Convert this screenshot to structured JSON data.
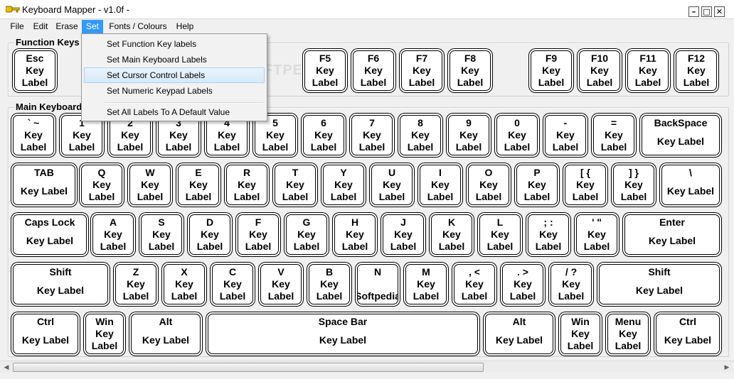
{
  "window": {
    "title": "Keyboard Mapper - v1.0f  -",
    "min": "–",
    "max": "□",
    "close": "✕"
  },
  "menu": {
    "items": [
      "File",
      "Edit",
      "Erase",
      "Set",
      "Fonts / Colours",
      "Help"
    ],
    "active": "Set"
  },
  "dropdown": {
    "items": [
      "Set Function Key labels",
      "Set Main Keyboard Labels",
      "Set Cursor Control Labels",
      "Set Numeric Keypad Labels",
      "Set All Labels To A Default Value"
    ],
    "hover_index": 2
  },
  "groups": {
    "function_keys": "Function Keys",
    "main_keyboard": "Main Keyboard"
  },
  "watermark": "SOFTPEDIA",
  "function_keys": [
    {
      "name": "Esc",
      "label": "Key Label"
    },
    {
      "name": "F5",
      "label": "Key Label"
    },
    {
      "name": "F6",
      "label": "Key Label"
    },
    {
      "name": "F7",
      "label": "Key Label"
    },
    {
      "name": "F8",
      "label": "Key Label"
    },
    {
      "name": "F9",
      "label": "Key Label"
    },
    {
      "name": "F10",
      "label": "Key Label"
    },
    {
      "name": "F11",
      "label": "Key Label"
    },
    {
      "name": "F12",
      "label": "Key Label"
    }
  ],
  "rows": [
    [
      {
        "name": "` ~",
        "label": "Key Label"
      },
      {
        "name": "1",
        "label": "Key Label"
      },
      {
        "name": "2",
        "label": "Key Label"
      },
      {
        "name": "3",
        "label": "Key Label"
      },
      {
        "name": "4",
        "label": "Key Label"
      },
      {
        "name": "5",
        "label": "Key Label"
      },
      {
        "name": "6",
        "label": "Key Label"
      },
      {
        "name": "7",
        "label": "Key Label"
      },
      {
        "name": "8",
        "label": "Key Label"
      },
      {
        "name": "9",
        "label": "Key Label"
      },
      {
        "name": "0",
        "label": "Key Label"
      },
      {
        "name": "-",
        "label": "Key Label"
      },
      {
        "name": "=",
        "label": "Key Label"
      },
      {
        "name": "BackSpace",
        "label": "Key Label"
      }
    ],
    [
      {
        "name": "TAB",
        "label": "Key Label"
      },
      {
        "name": "Q",
        "label": "Key Label"
      },
      {
        "name": "W",
        "label": "Key Label"
      },
      {
        "name": "E",
        "label": "Key Label"
      },
      {
        "name": "R",
        "label": "Key Label"
      },
      {
        "name": "T",
        "label": "Key Label"
      },
      {
        "name": "Y",
        "label": "Key Label"
      },
      {
        "name": "U",
        "label": "Key Label"
      },
      {
        "name": "I",
        "label": "Key Label"
      },
      {
        "name": "O",
        "label": "Key Label"
      },
      {
        "name": "P",
        "label": "Key Label"
      },
      {
        "name": "[ {",
        "label": "Key Label"
      },
      {
        "name": "] }",
        "label": "Key Label"
      },
      {
        "name": "\\",
        "label": "Key Label"
      }
    ],
    [
      {
        "name": "Caps Lock",
        "label": "Key Label"
      },
      {
        "name": "A",
        "label": "Key Label"
      },
      {
        "name": "S",
        "label": "Key Label"
      },
      {
        "name": "D",
        "label": "Key Label"
      },
      {
        "name": "F",
        "label": "Key Label"
      },
      {
        "name": "G",
        "label": "Key Label"
      },
      {
        "name": "H",
        "label": "Key Label"
      },
      {
        "name": "J",
        "label": "Key Label"
      },
      {
        "name": "K",
        "label": "Key Label"
      },
      {
        "name": "L",
        "label": "Key Label"
      },
      {
        "name": "; :",
        "label": "Key Label"
      },
      {
        "name": "' \"",
        "label": "Key Label"
      },
      {
        "name": "Enter",
        "label": "Key Label"
      }
    ],
    [
      {
        "name": "Shift",
        "label": "Key Label"
      },
      {
        "name": "Z",
        "label": "Key Label"
      },
      {
        "name": "X",
        "label": "Key Label"
      },
      {
        "name": "C",
        "label": "Key Label"
      },
      {
        "name": "V",
        "label": "Key Label"
      },
      {
        "name": "B",
        "label": "Key Label"
      },
      {
        "name": "N",
        "label": "Softpedia"
      },
      {
        "name": "M",
        "label": "Key Label"
      },
      {
        "name": ", <",
        "label": "Key Label"
      },
      {
        "name": ". >",
        "label": "Key Label"
      },
      {
        "name": "/ ?",
        "label": "Key Label"
      },
      {
        "name": "Shift",
        "label": "Key Label"
      }
    ],
    [
      {
        "name": "Ctrl",
        "label": "Key Label"
      },
      {
        "name": "Win",
        "label": "Key Label"
      },
      {
        "name": "Alt",
        "label": "Key Label"
      },
      {
        "name": "Space Bar",
        "label": "Key Label"
      },
      {
        "name": "Alt",
        "label": "Key Label"
      },
      {
        "name": "Win",
        "label": "Key Label"
      },
      {
        "name": "Menu",
        "label": "Key Label"
      },
      {
        "name": "Ctrl",
        "label": "Key Label"
      }
    ]
  ],
  "scrollbar": {
    "left": "◀",
    "right": "▶"
  }
}
